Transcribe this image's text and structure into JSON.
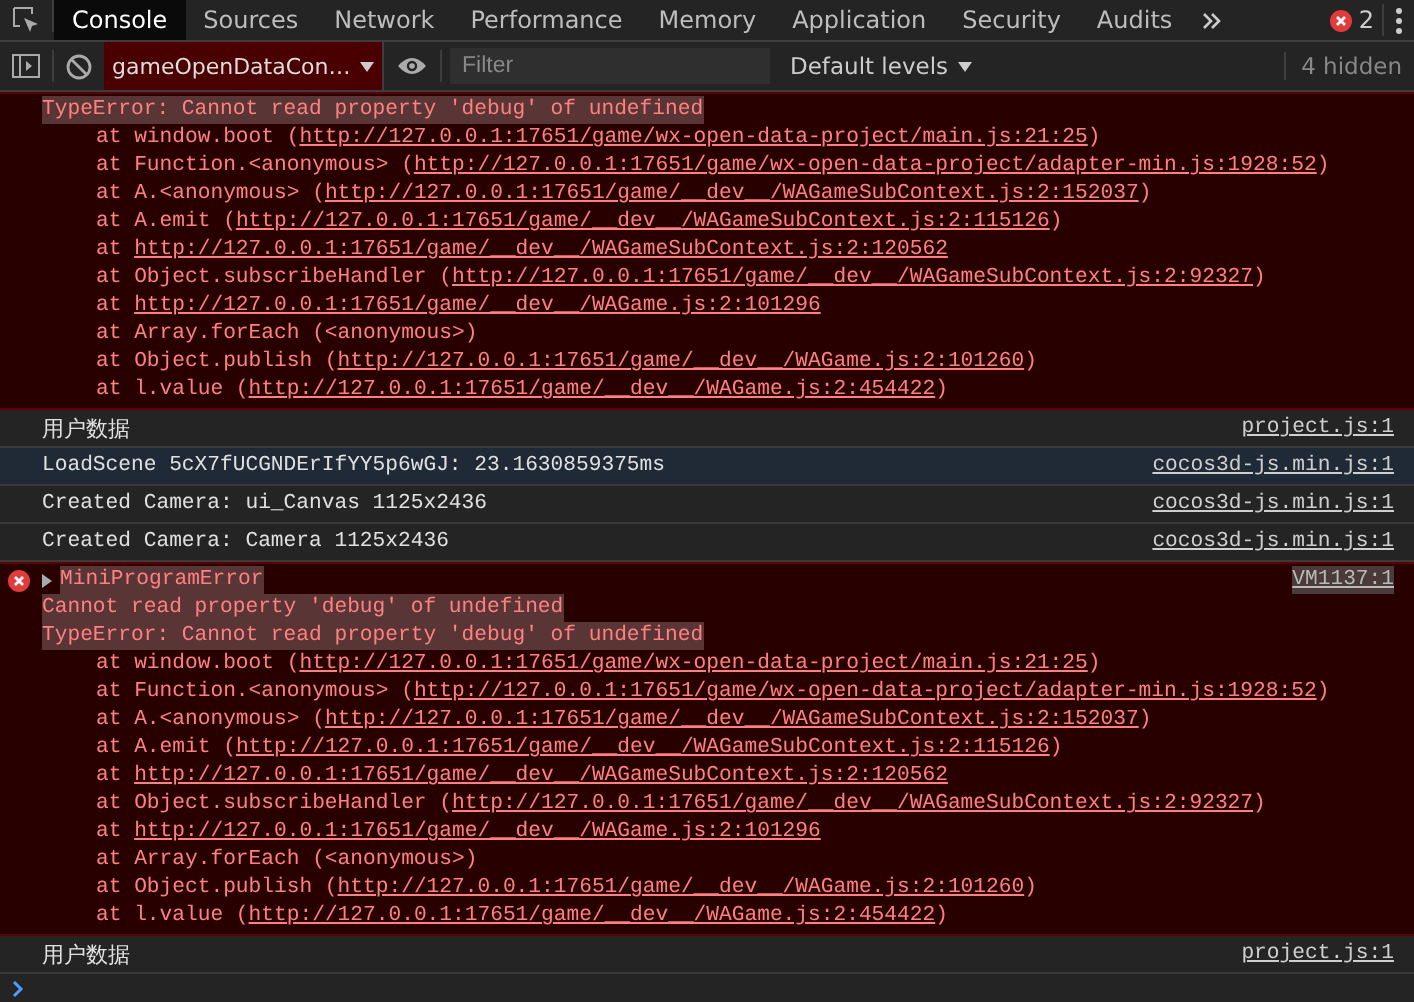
{
  "tabs": [
    {
      "label": "Console",
      "selected": true
    },
    {
      "label": "Sources",
      "selected": false
    },
    {
      "label": "Network",
      "selected": false
    },
    {
      "label": "Performance",
      "selected": false
    },
    {
      "label": "Memory",
      "selected": false
    },
    {
      "label": "Application",
      "selected": false
    },
    {
      "label": "Security",
      "selected": false
    },
    {
      "label": "Audits",
      "selected": false
    }
  ],
  "error_count": "2",
  "toolbar": {
    "context": "gameOpenDataCon…",
    "filter_placeholder": "Filter",
    "levels": "Default levels",
    "hidden": "4 hidden"
  },
  "messages": [
    {
      "kind": "error",
      "lines": [
        "TypeError: Cannot read property 'debug' of undefined"
      ],
      "stack": [
        {
          "text": "at window.boot (",
          "url": "http://127.0.0.1:17651/game/wx-open-data-project/main.js:21:25",
          "end": ")"
        },
        {
          "text": "at Function.<anonymous> (",
          "url": "http://127.0.0.1:17651/game/wx-open-data-project/adapter-min.js:1928:52",
          "end": ")"
        },
        {
          "text": "at A.<anonymous> (",
          "url": "http://127.0.0.1:17651/game/__dev__/WAGameSubContext.js:2:152037",
          "end": ")"
        },
        {
          "text": "at A.emit (",
          "url": "http://127.0.0.1:17651/game/__dev__/WAGameSubContext.js:2:115126",
          "end": ")"
        },
        {
          "text": "at ",
          "url": "http://127.0.0.1:17651/game/__dev__/WAGameSubContext.js:2:120562"
        },
        {
          "text": "at Object.subscribeHandler (",
          "url": "http://127.0.0.1:17651/game/__dev__/WAGameSubContext.js:2:92327",
          "end": ")"
        },
        {
          "text": "at ",
          "url": "http://127.0.0.1:17651/game/__dev__/WAGame.js:2:101296"
        },
        {
          "text": "at Array.forEach (<anonymous>)"
        },
        {
          "text": "at Object.publish (",
          "url": "http://127.0.0.1:17651/game/__dev__/WAGame.js:2:101260",
          "end": ")"
        },
        {
          "text": "at l.value (",
          "url": "http://127.0.0.1:17651/game/__dev__/WAGame.js:2:454422",
          "end": ")"
        }
      ]
    },
    {
      "kind": "log",
      "text": "用户数据",
      "source": "project.js:1",
      "hovered": false
    },
    {
      "kind": "log",
      "text": "LoadScene 5cX7fUCGNDErIfYY5p6wGJ: 23.1630859375ms",
      "source": "cocos3d-js.min.js:1",
      "hovered": true
    },
    {
      "kind": "log",
      "text": "Created Camera: ui_Canvas 1125x2436",
      "source": "cocos3d-js.min.js:1",
      "hovered": false
    },
    {
      "kind": "log",
      "text": "Created Camera: Camera 1125x2436",
      "source": "cocos3d-js.min.js:1",
      "hovered": false
    },
    {
      "kind": "error",
      "title": "MiniProgramError",
      "source": "VM1137:1",
      "lines": [
        "Cannot read property 'debug' of undefined",
        "TypeError: Cannot read property 'debug' of undefined"
      ],
      "stack": [
        {
          "text": "at window.boot (",
          "url": "http://127.0.0.1:17651/game/wx-open-data-project/main.js:21:25",
          "end": ")"
        },
        {
          "text": "at Function.<anonymous> (",
          "url": "http://127.0.0.1:17651/game/wx-open-data-project/adapter-min.js:1928:52",
          "end": ")"
        },
        {
          "text": "at A.<anonymous> (",
          "url": "http://127.0.0.1:17651/game/__dev__/WAGameSubContext.js:2:152037",
          "end": ")"
        },
        {
          "text": "at A.emit (",
          "url": "http://127.0.0.1:17651/game/__dev__/WAGameSubContext.js:2:115126",
          "end": ")"
        },
        {
          "text": "at ",
          "url": "http://127.0.0.1:17651/game/__dev__/WAGameSubContext.js:2:120562"
        },
        {
          "text": "at Object.subscribeHandler (",
          "url": "http://127.0.0.1:17651/game/__dev__/WAGameSubContext.js:2:92327",
          "end": ")"
        },
        {
          "text": "at ",
          "url": "http://127.0.0.1:17651/game/__dev__/WAGame.js:2:101296"
        },
        {
          "text": "at Array.forEach (<anonymous>)"
        },
        {
          "text": "at Object.publish (",
          "url": "http://127.0.0.1:17651/game/__dev__/WAGame.js:2:101260",
          "end": ")"
        },
        {
          "text": "at l.value (",
          "url": "http://127.0.0.1:17651/game/__dev__/WAGame.js:2:454422",
          "end": ")"
        }
      ]
    },
    {
      "kind": "log",
      "text": "用户数据",
      "source": "project.js:1",
      "hovered": false
    }
  ]
}
